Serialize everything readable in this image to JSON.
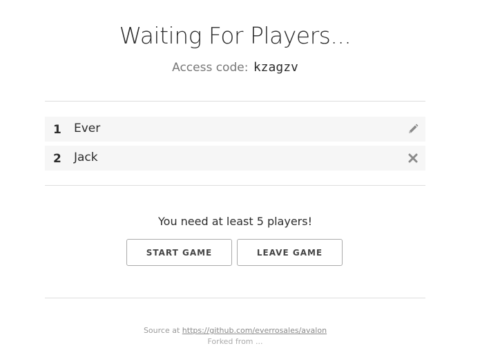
{
  "header": {
    "title": "Waiting For Players...",
    "access_label": "Access code:",
    "access_code": "kzagzv"
  },
  "players": [
    {
      "number": "1",
      "name": "Ever",
      "action_icon": "pencil-icon"
    },
    {
      "number": "2",
      "name": "Jack",
      "action_icon": "close-icon"
    }
  ],
  "status_message": "You need at least 5 players!",
  "buttons": {
    "start_label": "START GAME",
    "leave_label": "LEAVE GAME"
  },
  "footer": {
    "source_prefix": "Source at",
    "source_link": "https://github.com/everrosales/avalon",
    "second_line": "Forked from ..."
  },
  "colors": {
    "text": "#2b2b2b",
    "muted": "#777777",
    "row_bg": "#f6f6f6",
    "divider": "#dddddd",
    "button_border": "#aaaaaa"
  }
}
